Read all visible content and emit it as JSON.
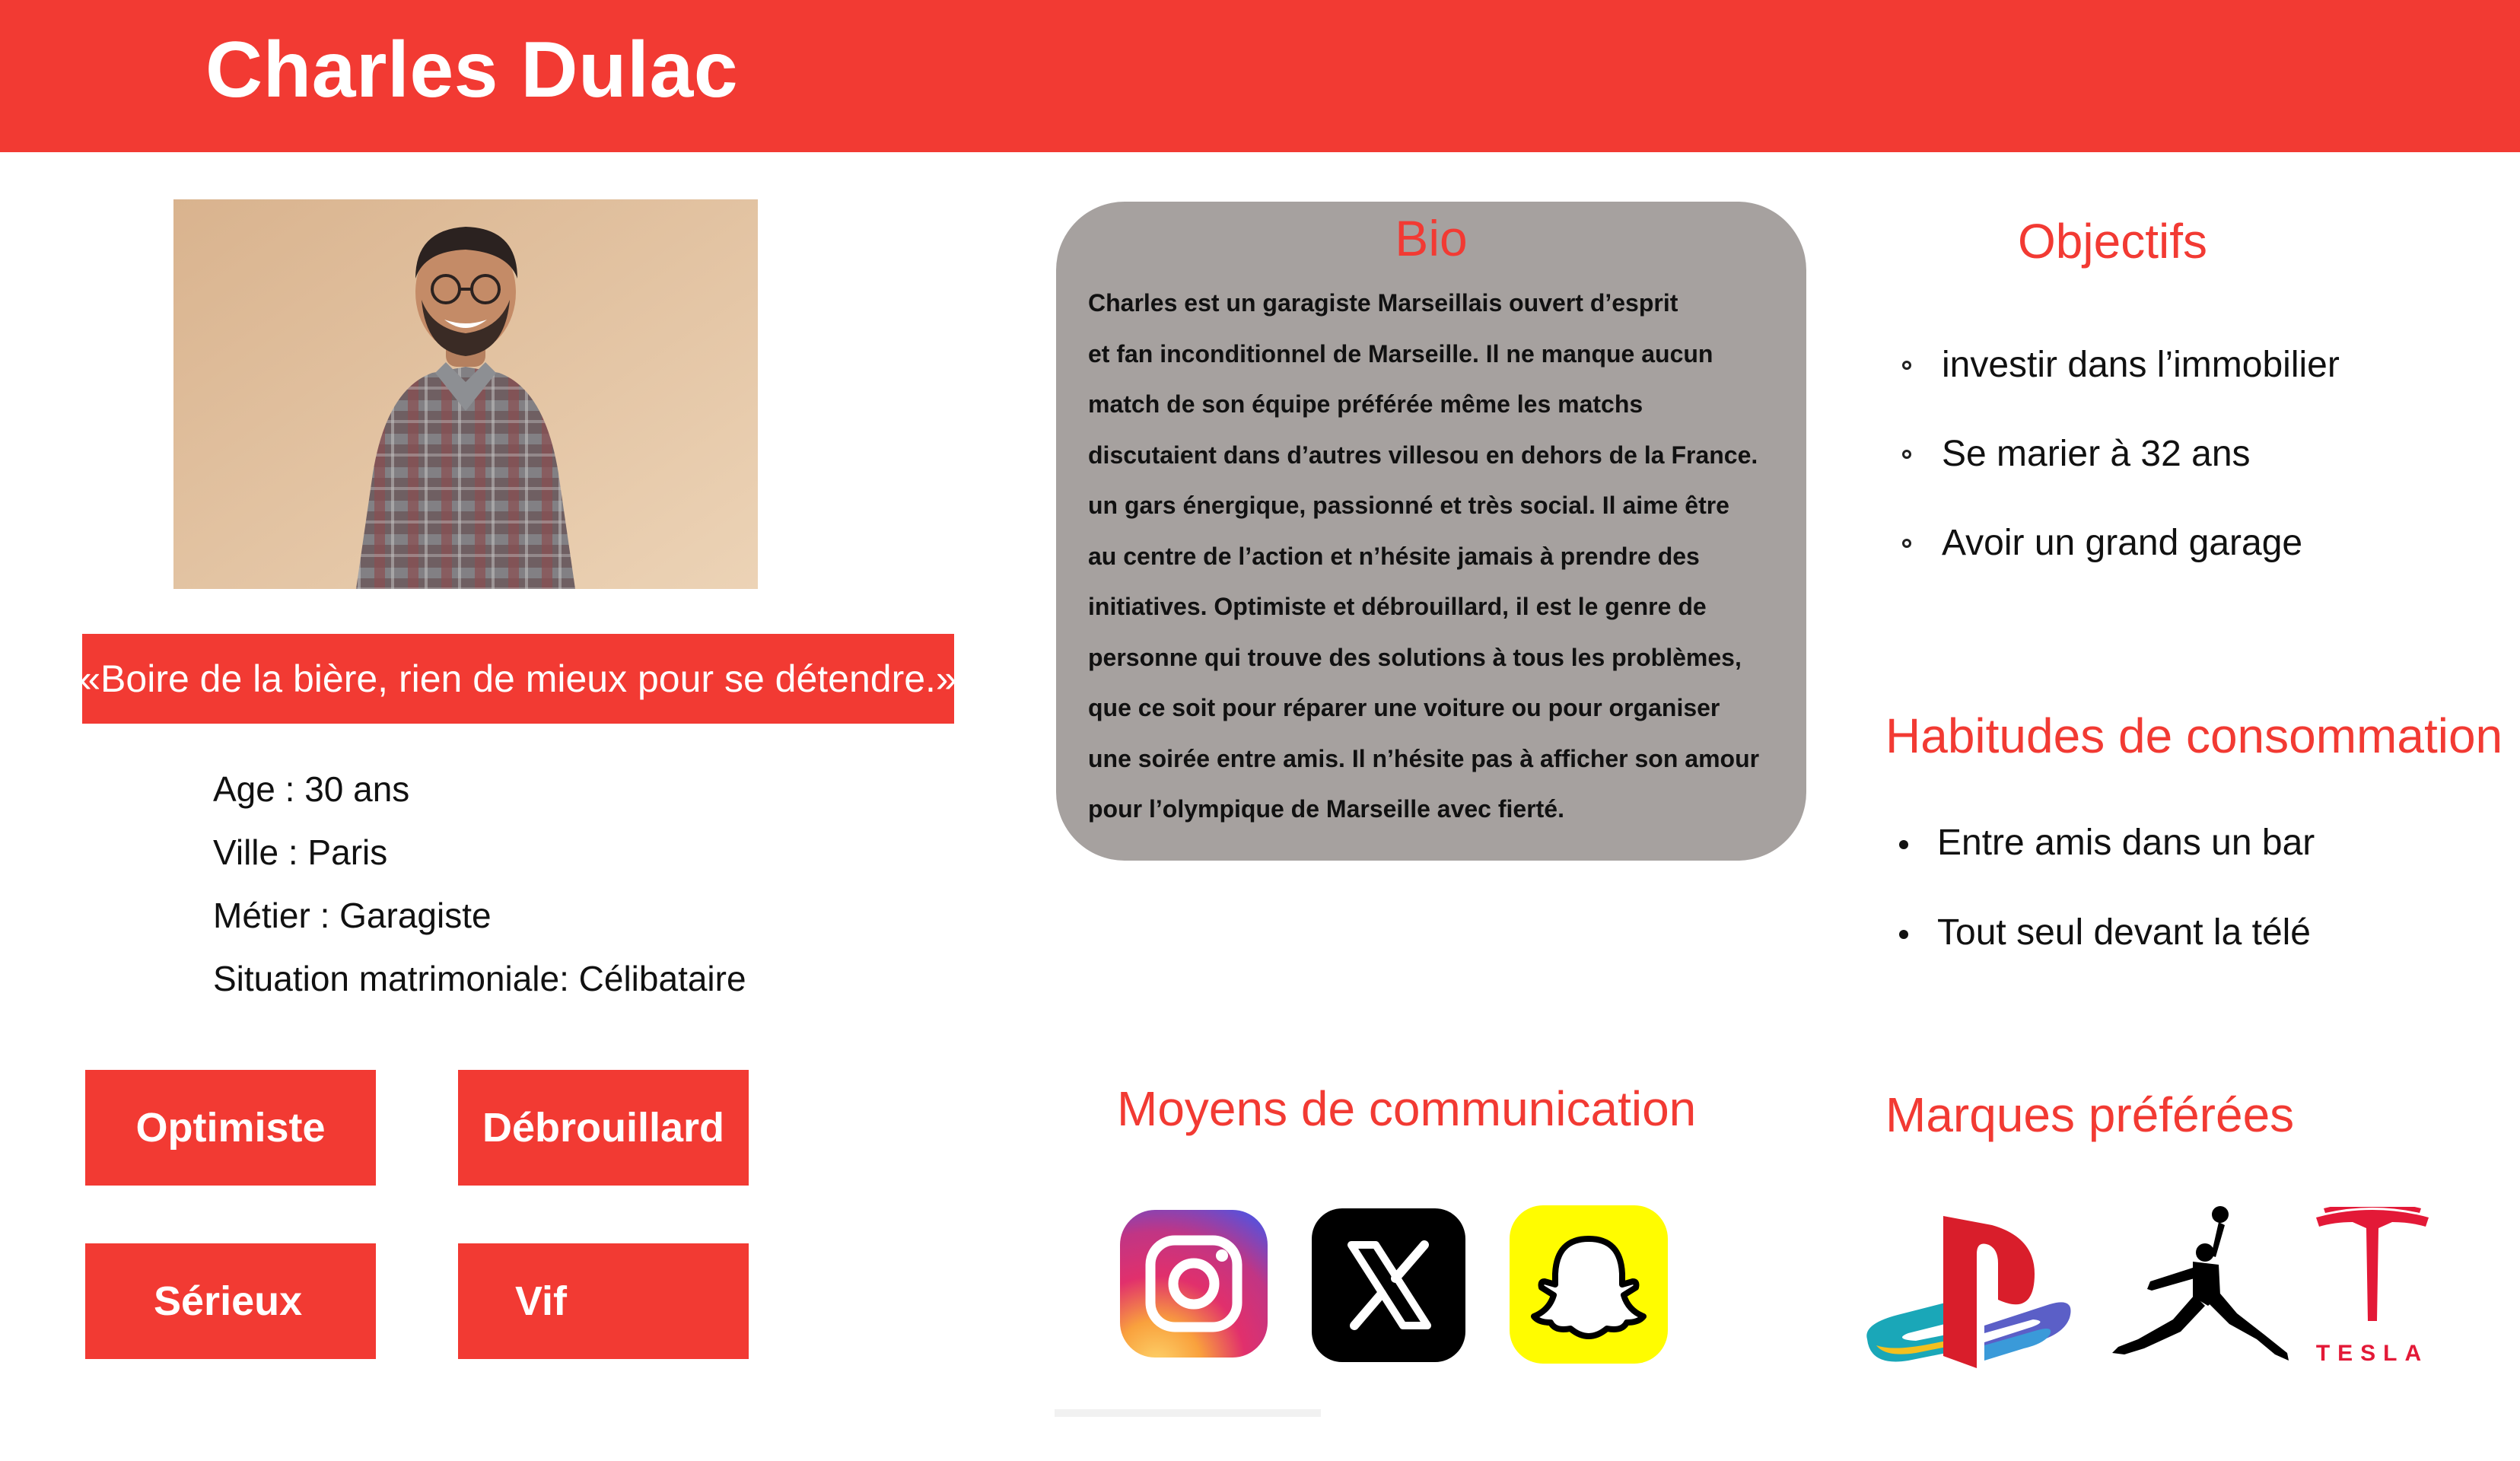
{
  "header": {
    "name": "Charles Dulac",
    "color": "#f23a33"
  },
  "profile": {
    "quote": "«Boire de la bière, rien de mieux pour se détendre.»",
    "info": [
      "Age : 30 ans",
      "Ville : Paris",
      "Métier : Garagiste",
      "Situation matrimoniale: Célibataire"
    ],
    "traits": [
      "Optimiste",
      "Débrouillard",
      "Sérieux",
      "Vif"
    ]
  },
  "bio": {
    "title": "Bio",
    "lines": [
      "Charles  est un garagiste Marseillais  ouvert d’esprit",
      "et fan inconditionnel de Marseille. Il ne manque aucun",
      "match de son équipe préférée même les matchs",
      "discutaient dans d’autres villesou en dehors de la France.",
      "un gars énergique, passionné et très social. Il aime être",
      "au centre de l’action et n’hésite jamais à prendre des",
      "initiatives. Optimiste et débrouillard, il est le genre de",
      "personne qui trouve des solutions à tous les problèmes,",
      "que ce soit pour réparer une voiture ou pour organiser",
      "une soirée entre amis. Il n’hésite pas à afficher son amour",
      "pour l’olympique de Marseille avec fierté."
    ]
  },
  "objectifs": {
    "title": "Objectifs",
    "items": [
      "investir dans l’immobilier",
      "Se marier à 32 ans",
      "Avoir un grand garage"
    ]
  },
  "habitudes": {
    "title": "Habitudes de consommation",
    "items": [
      "Entre amis dans un bar",
      "Tout seul devant la télé"
    ]
  },
  "communication": {
    "title": "Moyens de communication",
    "icons": [
      "instagram-icon",
      "x-icon",
      "snapchat-icon"
    ]
  },
  "marques": {
    "title": "Marques préférées",
    "logos": [
      "playstation-logo",
      "jordan-jumpman-logo",
      "tesla-logo"
    ],
    "tesla_wordmark": "TESLA"
  }
}
